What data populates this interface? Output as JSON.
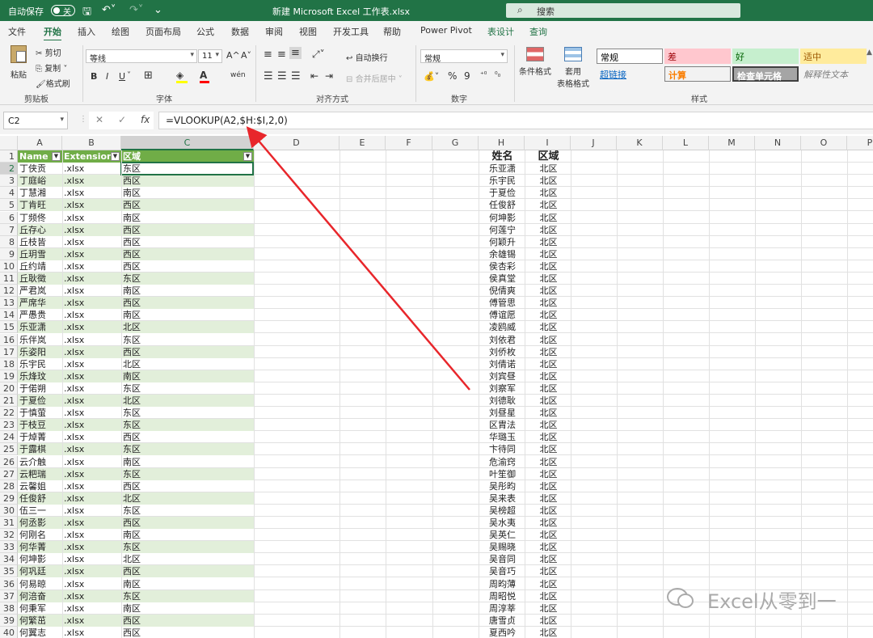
{
  "titlebar": {
    "autosave_label": "自动保存",
    "autosave_state": "关",
    "title": "新建 Microsoft Excel 工作表.xlsx",
    "search_placeholder": "搜索"
  },
  "menu": [
    "文件",
    "开始",
    "插入",
    "绘图",
    "页面布局",
    "公式",
    "数据",
    "审阅",
    "视图",
    "开发工具",
    "帮助",
    "Power Pivot",
    "表设计",
    "查询"
  ],
  "ribbon": {
    "clipboard": {
      "paste": "粘贴",
      "cut": "剪切",
      "copy": "复制",
      "format_painter": "格式刷",
      "label": "剪贴板"
    },
    "font": {
      "name": "等线",
      "size": "11",
      "label": "字体",
      "grow": "A^",
      "shrink": "A˅",
      "bold": "B",
      "italic": "I",
      "underline": "U",
      "wen": "wén"
    },
    "alignment": {
      "wrap": "自动换行",
      "merge": "合并后居中",
      "label": "对齐方式"
    },
    "number": {
      "format": "常规",
      "label": "数字",
      "percent": "%",
      "comma": "9"
    },
    "styles": {
      "cond_format": "条件格式",
      "table_format_1": "套用",
      "table_format_2": "表格格式",
      "label": "样式",
      "cells": [
        {
          "text": "常规",
          "bg": "#ffffff",
          "color": "#000000"
        },
        {
          "text": "差",
          "bg": "#ffc7ce",
          "color": "#9c0006"
        },
        {
          "text": "好",
          "bg": "#c6efce",
          "color": "#006100"
        },
        {
          "text": "适中",
          "bg": "#ffeb9c",
          "color": "#9c5700"
        },
        {
          "text": "超链接",
          "bg": "#f3f3f3",
          "color": "#0563c1"
        },
        {
          "text": "计算",
          "bg": "#f2f2f2",
          "color": "#fa7d00"
        },
        {
          "text": "检查单元格",
          "bg": "#a5a5a5",
          "color": "#ffffff"
        },
        {
          "text": "解释性文本",
          "bg": "#f3f3f3",
          "color": "#7f7f7f"
        }
      ]
    }
  },
  "formula_bar": {
    "name_box": "C2",
    "cancel": "✕",
    "enter": "✓",
    "fx": "fx",
    "formula": "=VLOOKUP(A2,$H:$I,2,0)"
  },
  "columns": [
    "A",
    "B",
    "C",
    "D",
    "E",
    "F",
    "G",
    "H",
    "I",
    "J",
    "K",
    "L",
    "M",
    "N",
    "O",
    "P"
  ],
  "table": {
    "headers": [
      "Name",
      "Extension",
      "区域"
    ],
    "rows": [
      [
        "丁侠贡",
        ".xlsx",
        "东区"
      ],
      [
        "丁庭峪",
        ".xlsx",
        "西区"
      ],
      [
        "丁慧湘",
        ".xlsx",
        "南区"
      ],
      [
        "丁肯旺",
        ".xlsx",
        "西区"
      ],
      [
        "丁频佟",
        ".xlsx",
        "南区"
      ],
      [
        "丘存心",
        ".xlsx",
        "西区"
      ],
      [
        "丘枝皆",
        ".xlsx",
        "西区"
      ],
      [
        "丘玥雪",
        ".xlsx",
        "西区"
      ],
      [
        "丘约靖",
        ".xlsx",
        "西区"
      ],
      [
        "丘耿徵",
        ".xlsx",
        "东区"
      ],
      [
        "严君岚",
        ".xlsx",
        "南区"
      ],
      [
        "严席华",
        ".xlsx",
        "西区"
      ],
      [
        "严愚贵",
        ".xlsx",
        "南区"
      ],
      [
        "乐亚潇",
        ".xlsx",
        "北区"
      ],
      [
        "乐伴岚",
        ".xlsx",
        "东区"
      ],
      [
        "乐姿阳",
        ".xlsx",
        "西区"
      ],
      [
        "乐宇民",
        ".xlsx",
        "北区"
      ],
      [
        "乐烽玟",
        ".xlsx",
        "南区"
      ],
      [
        "于偌朔",
        ".xlsx",
        "东区"
      ],
      [
        "于夏俭",
        ".xlsx",
        "北区"
      ],
      [
        "于慎萤",
        ".xlsx",
        "东区"
      ],
      [
        "于枝豆",
        ".xlsx",
        "东区"
      ],
      [
        "于焯菁",
        ".xlsx",
        "西区"
      ],
      [
        "于露棋",
        ".xlsx",
        "东区"
      ],
      [
        "云介触",
        ".xlsx",
        "南区"
      ],
      [
        "云粑瑞",
        ".xlsx",
        "东区"
      ],
      [
        "云馨姐",
        ".xlsx",
        "西区"
      ],
      [
        "任俊舒",
        ".xlsx",
        "北区"
      ],
      [
        "伍三一",
        ".xlsx",
        "东区"
      ],
      [
        "何丞影",
        ".xlsx",
        "西区"
      ],
      [
        "何刚名",
        ".xlsx",
        "南区"
      ],
      [
        "何华菁",
        ".xlsx",
        "东区"
      ],
      [
        "何坤影",
        ".xlsx",
        "北区"
      ],
      [
        "何巩廷",
        ".xlsx",
        "西区"
      ],
      [
        "何易晾",
        ".xlsx",
        "南区"
      ],
      [
        "何涪奋",
        ".xlsx",
        "东区"
      ],
      [
        "何秉军",
        ".xlsx",
        "南区"
      ],
      [
        "何繁茁",
        ".xlsx",
        "西区"
      ],
      [
        "何翼志",
        ".xlsx",
        "西区"
      ]
    ]
  },
  "lookup": {
    "headers": [
      "姓名",
      "区域"
    ],
    "rows": [
      [
        "乐亚潇",
        "北区"
      ],
      [
        "乐宇民",
        "北区"
      ],
      [
        "于夏俭",
        "北区"
      ],
      [
        "任俊舒",
        "北区"
      ],
      [
        "何坤影",
        "北区"
      ],
      [
        "何莲宁",
        "北区"
      ],
      [
        "何颖升",
        "北区"
      ],
      [
        "余雄锡",
        "北区"
      ],
      [
        "侯杏彩",
        "北区"
      ],
      [
        "侯真堂",
        "北区"
      ],
      [
        "倪倩爽",
        "北区"
      ],
      [
        "傅管思",
        "北区"
      ],
      [
        "傅谊愿",
        "北区"
      ],
      [
        "凌鸥威",
        "北区"
      ],
      [
        "刘依君",
        "北区"
      ],
      [
        "刘侨枚",
        "北区"
      ],
      [
        "刘倩诺",
        "北区"
      ],
      [
        "刘宾昼",
        "北区"
      ],
      [
        "刘察军",
        "北区"
      ],
      [
        "刘德耿",
        "北区"
      ],
      [
        "刘昼星",
        "北区"
      ],
      [
        "区胄法",
        "北区"
      ],
      [
        "华璐玉",
        "北区"
      ],
      [
        "卞待同",
        "北区"
      ],
      [
        "危渝窍",
        "北区"
      ],
      [
        "叶笙御",
        "北区"
      ],
      [
        "吴彤昀",
        "北区"
      ],
      [
        "吴来表",
        "北区"
      ],
      [
        "吴榜超",
        "北区"
      ],
      [
        "吴水夷",
        "北区"
      ],
      [
        "吴英仁",
        "北区"
      ],
      [
        "吴赐晓",
        "北区"
      ],
      [
        "吴音同",
        "北区"
      ],
      [
        "吴音巧",
        "北区"
      ],
      [
        "周昀薄",
        "北区"
      ],
      [
        "周昭悦",
        "北区"
      ],
      [
        "周淳莘",
        "北区"
      ],
      [
        "唐雪贞",
        "北区"
      ],
      [
        "夏西吟",
        "北区"
      ]
    ]
  },
  "watermark": "Excel从零到一"
}
